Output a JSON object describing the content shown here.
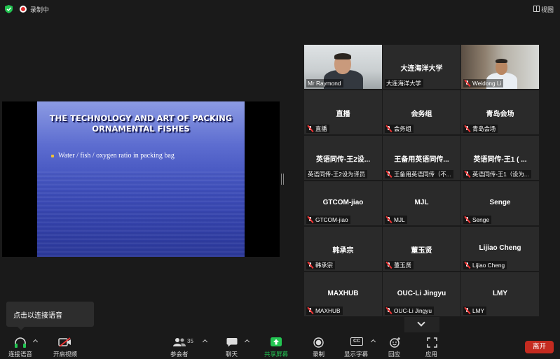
{
  "topbar": {
    "recording_label": "录制中",
    "view_label": "视图"
  },
  "slide": {
    "title_line1": "THE TECHNOLOGY AND ART OF PACKING",
    "title_line2": "ORNAMENTAL FISHES",
    "bullet": "Water / fish / oxygen ratio in packing bag"
  },
  "participants": [
    {
      "name": "Mr Raymond",
      "display": "",
      "video": true,
      "muted": false,
      "active_speaker": true
    },
    {
      "name": "大连海洋大学",
      "display": "大连海洋大学",
      "video": false,
      "muted": false
    },
    {
      "name": "Weidong Li",
      "display": "",
      "video": true,
      "muted": true
    },
    {
      "name": "直播",
      "display": "直播",
      "video": false,
      "muted": true
    },
    {
      "name": "会务组",
      "display": "会务组",
      "video": false,
      "muted": true
    },
    {
      "name": "青岛会场",
      "display": "青岛会场",
      "video": false,
      "muted": true
    },
    {
      "name": "英语同传-王2设为译员",
      "display": "英语同传-王2设...",
      "video": false,
      "muted": false
    },
    {
      "name": "王备用英语同传（不...",
      "display": "王备用英语同传...",
      "video": false,
      "muted": true
    },
    {
      "name": "英语同传-王1（设为...",
      "display": "英语同传-王1 ( ...",
      "video": false,
      "muted": true
    },
    {
      "name": "GTCOM-jiao",
      "display": "GTCOM-jiao",
      "video": false,
      "muted": true
    },
    {
      "name": "MJL",
      "display": "MJL",
      "video": false,
      "muted": true
    },
    {
      "name": "Senge",
      "display": "Senge",
      "video": false,
      "muted": true
    },
    {
      "name": "韩承宗",
      "display": "韩承宗",
      "video": false,
      "muted": true
    },
    {
      "name": "董玉贤",
      "display": "董玉贤",
      "video": false,
      "muted": true
    },
    {
      "name": "Lijiao Cheng",
      "display": "Lijiao Cheng",
      "video": false,
      "muted": true
    },
    {
      "name": "MAXHUB",
      "display": "MAXHUB",
      "video": false,
      "muted": true
    },
    {
      "name": "OUC-Li Jingyu",
      "display": "OUC-Li Jingyu",
      "video": false,
      "muted": true
    },
    {
      "name": "LMY",
      "display": "LMY",
      "video": false,
      "muted": true
    }
  ],
  "tooltip": "点击以连接语音",
  "toolbar": {
    "audio": "连接语音",
    "video": "开启视频",
    "participants": "参会者",
    "participants_count": "35",
    "chat": "聊天",
    "share": "共享屏幕",
    "record": "录制",
    "captions": "显示字幕",
    "captions_icon_text": "CC",
    "reactions": "回应",
    "apps": "应用",
    "leave": "离开"
  },
  "colors": {
    "background": "#1a1a1a",
    "tile": "#2a2a2a",
    "active_speaker_border": "#b9e26b",
    "share_green": "#23c552",
    "leave_red": "#c42b20",
    "security_green": "#23c552",
    "recording_red": "#e02828"
  }
}
